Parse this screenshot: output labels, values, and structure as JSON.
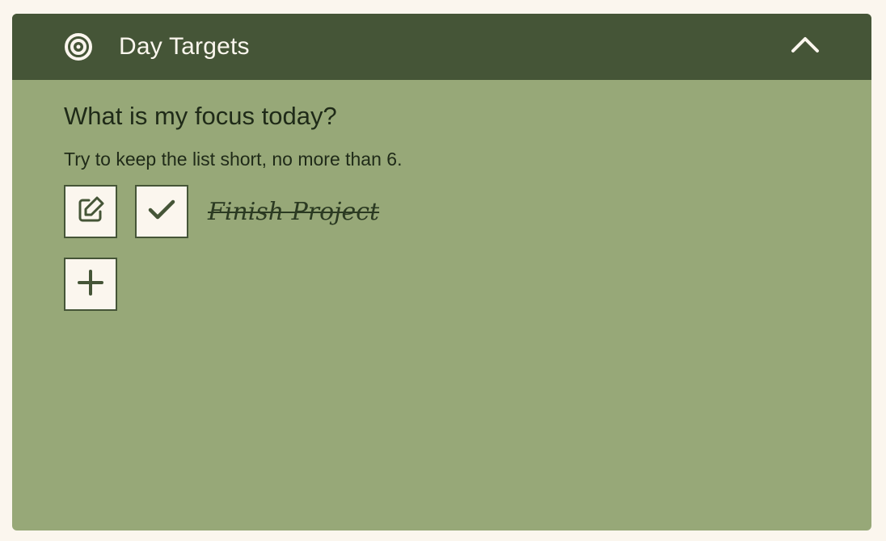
{
  "header": {
    "title": "Day Targets",
    "icon": "target-icon",
    "collapse_icon": "chevron-up-icon"
  },
  "main": {
    "question": "What is my focus today?",
    "hint": "Try to keep the list short, no more than 6.",
    "tasks": [
      {
        "label": "Finish Project",
        "completed": true
      }
    ],
    "add_icon": "plus-icon",
    "edit_icon": "edit-icon",
    "check_icon": "check-icon"
  },
  "colors": {
    "header_bg": "#455537",
    "panel_bg": "#97a878",
    "page_bg": "#fbf6ee",
    "button_bg": "#fbf6ee",
    "accent_dark": "#455537",
    "text_dark": "#1f2a18"
  }
}
